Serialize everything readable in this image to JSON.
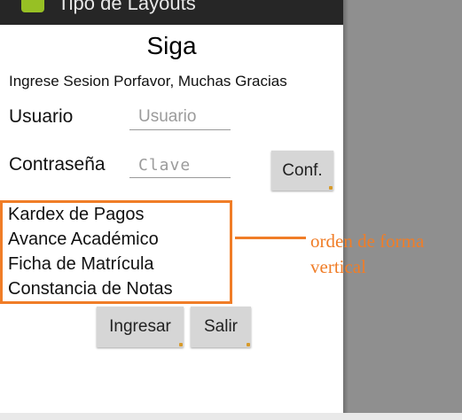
{
  "window": {
    "title": "Tipo de Layouts",
    "icon": "android-icon"
  },
  "form": {
    "heading": "Siga",
    "subheading": "Ingrese Sesion Porfavor, Muchas Gracias",
    "user_label": "Usuario",
    "user_placeholder": "Usuario",
    "user_value": "",
    "password_label": "Contraseña",
    "password_placeholder": "Clave",
    "password_value": "",
    "confirm_button": "Conf."
  },
  "options": [
    {
      "label": "Kardex de Pagos"
    },
    {
      "label": "Avance Académico"
    },
    {
      "label": "Ficha de Matrícula"
    },
    {
      "label": "Constancia de Notas"
    }
  ],
  "actions": {
    "login_button": "Ingresar",
    "exit_button": "Salir"
  },
  "annotation": {
    "line1": "orden de forma",
    "line2": "vertical",
    "color": "#f07d27"
  }
}
